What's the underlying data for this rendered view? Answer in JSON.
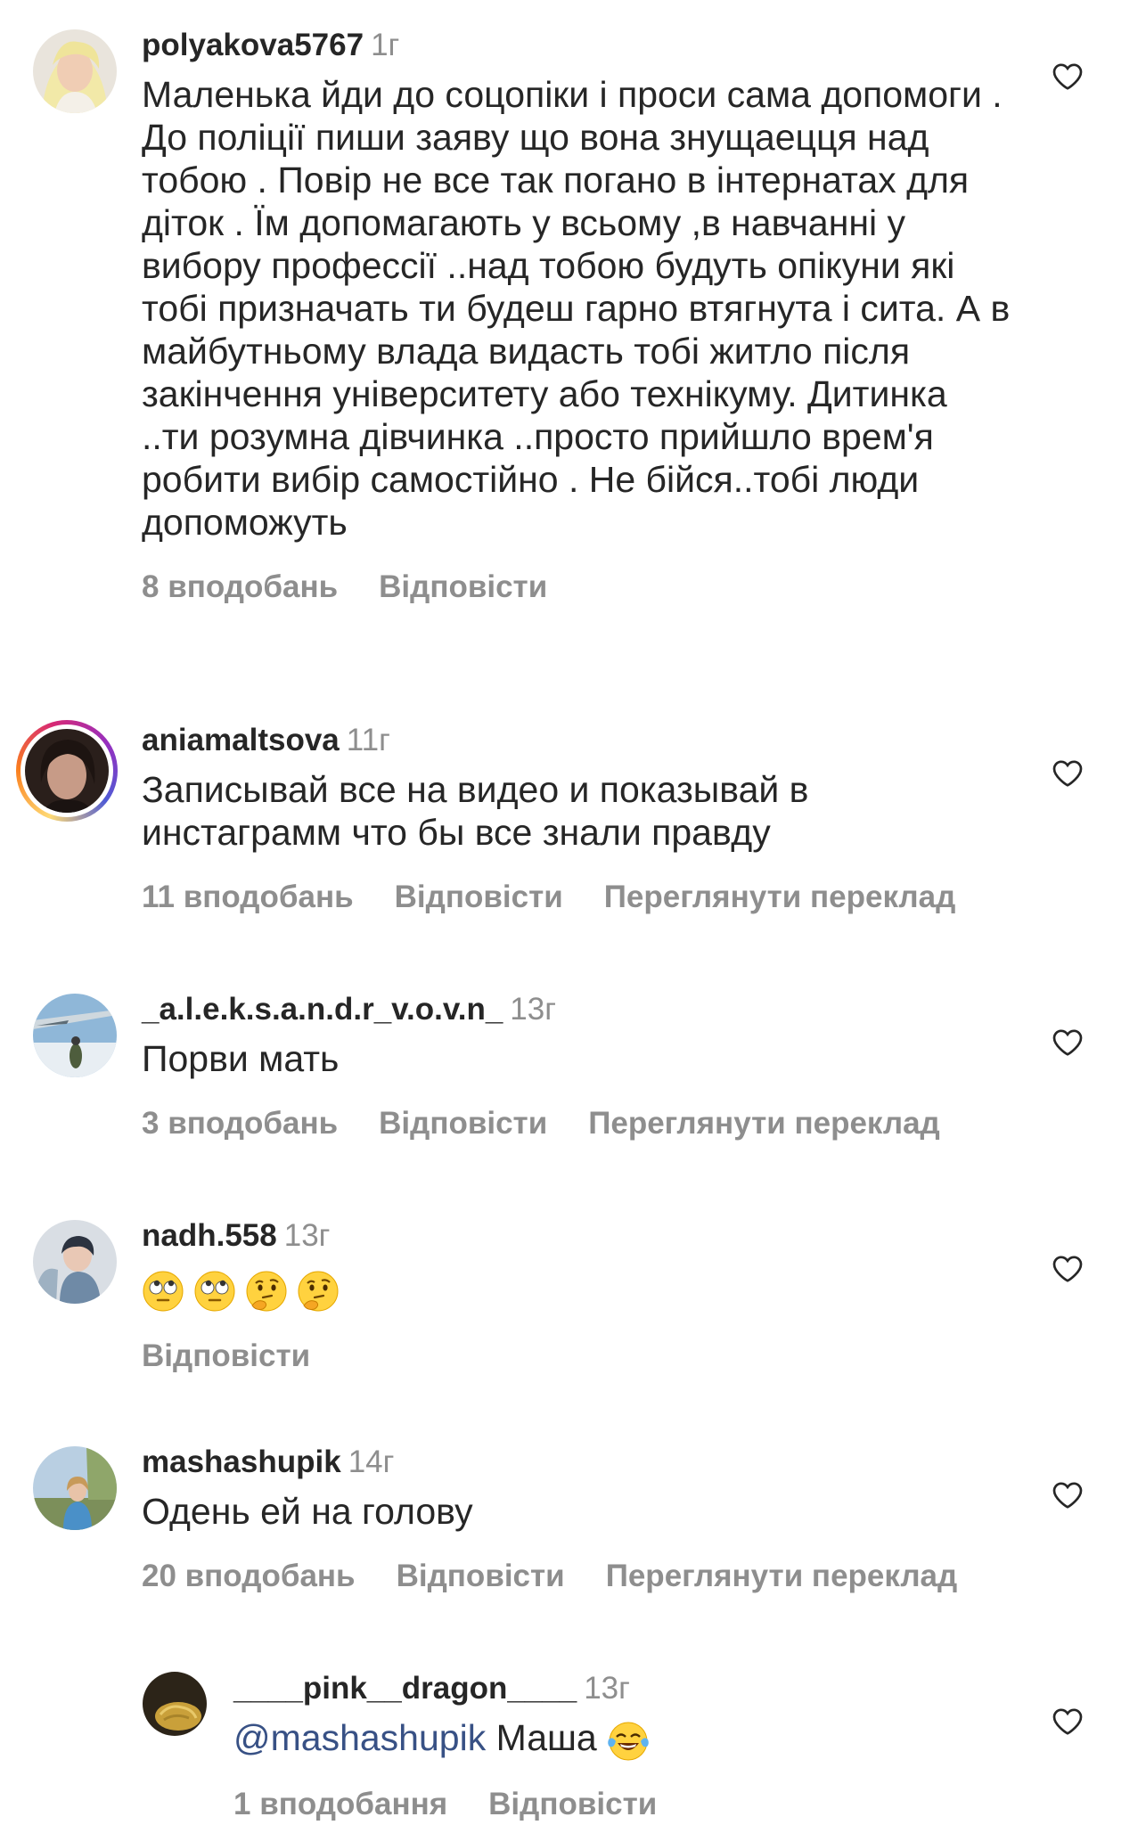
{
  "comments": [
    {
      "username": "polyakova5767",
      "time": "1г",
      "text": "Маленька йди до соцопіки і проси сама допомоги . До поліції пиши заяву що вона знущаецця над тобою . Повір не все так погано в інтернатах для діток . Їм допомагають у всьому ,в навчанні у вибору профессії ..над тобою будуть опікуни які тобі призначать ти будеш гарно втягнута і сита. А в майбутньому влада видасть тобі житло після закінчення університету або технікуму. Дитинка ..ти розумна дівчинка ..просто прийшло врем'я робити вибір самостійно . Не бійся..тобі люди допоможуть",
      "likes": "8 вподобань",
      "reply": "Відповісти"
    },
    {
      "username": "aniamaltsova",
      "time": "11г",
      "text": "Записывай все на видео и показывай в инстаграмм что бы все знали правду",
      "likes": "11 вподобань",
      "reply": "Відповісти",
      "translate": "Переглянути переклад"
    },
    {
      "username": "_a.l.e.k.s.a.n.d.r_v.o.v.n_",
      "time": "13г",
      "text": "Порви мать",
      "likes": "3 вподобань",
      "reply": "Відповісти",
      "translate": "Переглянути переклад"
    },
    {
      "username": "nadh.558",
      "time": "13г",
      "emojis": [
        "face-with-rolling-eyes",
        "face-with-rolling-eyes",
        "thinking-face",
        "thinking-face"
      ],
      "reply": "Відповісти"
    },
    {
      "username": "mashashupik",
      "time": "14г",
      "text": "Одень ей на голову",
      "likes": "20 вподобань",
      "reply": "Відповісти",
      "translate": "Переглянути переклад"
    },
    {
      "username": "____pink__dragon____",
      "time": "13г",
      "mention": "@mashashupik",
      "text": "Маша",
      "emoji": "face-with-tears-of-joy",
      "likes": "1 вподобання",
      "reply": "Відповісти"
    }
  ],
  "icons": {
    "like": "heart-outline-icon"
  },
  "colors": {
    "text": "#262626",
    "secondary": "#8e8e8e",
    "mention": "#385185"
  }
}
